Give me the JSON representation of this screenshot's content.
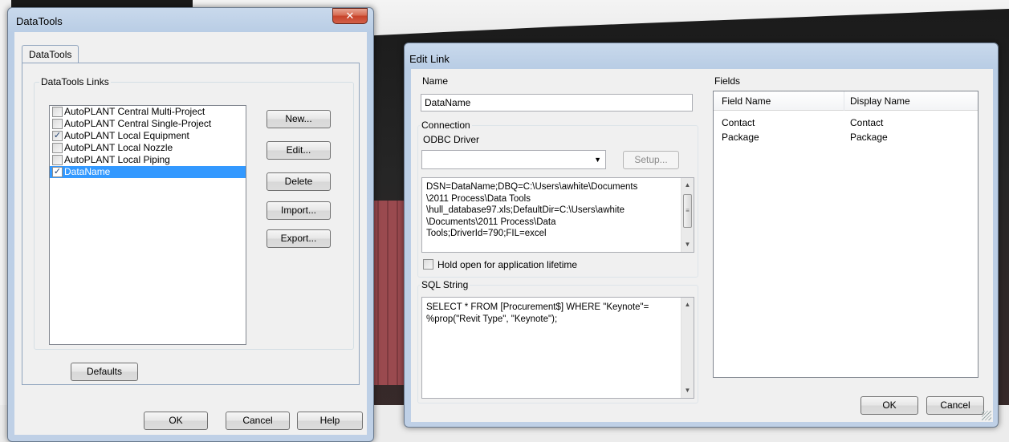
{
  "datatools_window": {
    "title": "DataTools",
    "close_glyph": "✕",
    "tab": "DataTools",
    "group_label": "DataTools Links",
    "links": [
      {
        "label": "AutoPLANT Central Multi-Project",
        "checked": false,
        "selected": false
      },
      {
        "label": "AutoPLANT Central Single-Project",
        "checked": false,
        "selected": false
      },
      {
        "label": "AutoPLANT Local Equipment",
        "checked": true,
        "selected": false
      },
      {
        "label": "AutoPLANT Local Nozzle",
        "checked": false,
        "selected": false
      },
      {
        "label": "AutoPLANT Local Piping",
        "checked": false,
        "selected": false
      },
      {
        "label": "DataName",
        "checked": true,
        "selected": true
      }
    ],
    "buttons": {
      "new": "New...",
      "edit": "Edit...",
      "delete": "Delete",
      "import": "Import...",
      "export": "Export...",
      "defaults": "Defaults",
      "ok": "OK",
      "cancel": "Cancel",
      "help": "Help"
    }
  },
  "edit_link_window": {
    "title": "Edit Link",
    "name_label": "Name",
    "name_value": "DataName",
    "connection_label": "Connection",
    "odbc_label": "ODBC Driver",
    "odbc_value": "",
    "setup_button": "Setup...",
    "connection_string": "DSN=DataName;DBQ=C:\\Users\\awhite\\Documents\n\\2011 Process\\Data Tools\n\\hull_database97.xls;DefaultDir=C:\\Users\\awhite\n\\Documents\\2011 Process\\Data\nTools;DriverId=790;FIL=excel",
    "hold_open_label": "Hold open for application lifetime",
    "hold_open_checked": false,
    "sql_label": "SQL String",
    "sql_value": "SELECT * FROM [Procurement$] WHERE \"Keynote\"=\n%prop(\"Revit Type\", \"Keynote\");",
    "fields_label": "Fields",
    "fields_columns": [
      "Field Name",
      "Display Name"
    ],
    "fields_rows": [
      {
        "field": "Contact",
        "display": "Contact"
      },
      {
        "field": "Package",
        "display": "Package"
      }
    ],
    "ok_button": "OK",
    "cancel_button": "Cancel"
  },
  "icons": {
    "checkmark": "✓",
    "dropdown_arrow": "▼",
    "scroll_up": "▲",
    "scroll_down": "▼",
    "thumb_grip": "≡"
  }
}
